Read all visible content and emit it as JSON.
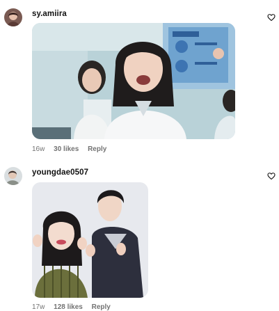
{
  "comments": [
    {
      "username": "sy.amiira",
      "age": "16w",
      "likes": "30 likes",
      "reply_label": "Reply",
      "like_icon": "heart-outline-icon"
    },
    {
      "username": "youngdae0507",
      "age": "17w",
      "likes": "128 likes",
      "reply_label": "Reply",
      "like_icon": "heart-outline-icon"
    }
  ],
  "colors": {
    "meta_text": "#737373",
    "username_text": "#111111"
  }
}
